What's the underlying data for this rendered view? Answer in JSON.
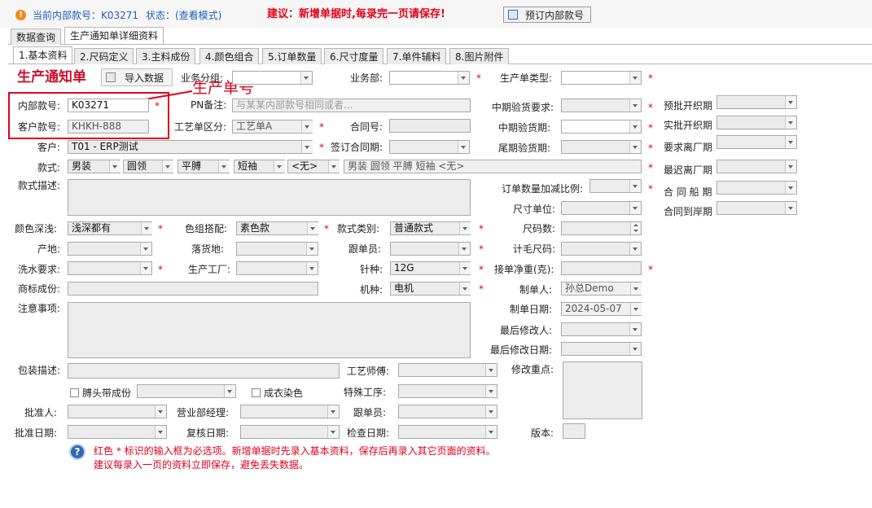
{
  "header": {
    "current_code_label": "当前内部款号：K03271",
    "status_label": "状态：(查看模式)",
    "advice": "建议：新增单据时,每录完一页请保存!",
    "reserve_button": "预订内部款号"
  },
  "main_tabs": [
    "数据查询",
    "生产通知单详细资料"
  ],
  "sub_tabs": [
    "1.基本资料",
    "2.尺码定义",
    "3.主料成份",
    "4.颜色组合",
    "5.订单数量",
    "6.尺寸度量",
    "7.单件辅料",
    "8.图片附件"
  ],
  "form": {
    "title": "生产通知单",
    "import_button": "导入数据",
    "annotation": "生产单号",
    "labels": {
      "biz_group": "业务分组:",
      "biz_dept": "业务部:",
      "order_type": "生产单类型:",
      "inner_code": "内部款号:",
      "pn_note": "PN备注:",
      "mid_check_req": "中期验货要求:",
      "pre_cut": "预批开织期",
      "cust_code": "客户款号:",
      "proc_section": "工艺单区分:",
      "contract_no": "合同号:",
      "mid_check_date": "中期验货期:",
      "actual_cut": "实批开织期",
      "customer": "客户:",
      "sign_date": "签订合同期:",
      "final_check": "尾期验货期:",
      "req_leave": "要求离厂期",
      "style": "款式:",
      "latest_leave": "最迟离厂期",
      "style_desc": "款式描述:",
      "qty_adjust": "订单数量加减比例:",
      "ship_date": "合 同 船 期",
      "size_unit": "尺寸单位:",
      "arrival_date": "合同到岸期",
      "color_depth": "颜色深浅:",
      "color_match": "色组搭配:",
      "style_cat": "款式类别:",
      "size_count": "尺码数:",
      "origin": "产地:",
      "delivery": "落货地:",
      "follower": "跟单员:",
      "gauge_size": "计毛尺码:",
      "wash": "洗水要求:",
      "factory": "生产工厂:",
      "needle": "针种:",
      "net_weight": "接单净重(克):",
      "trademark": "商标成份:",
      "machine": "机种:",
      "creator": "制单人:",
      "notes": "注意事项:",
      "create_date": "制单日期:",
      "last_modifier": "最后修改人:",
      "last_modify_date": "最后修改日期:",
      "packing": "包装描述:",
      "craftsman": "工艺师傅:",
      "key_mods": "修改重点:",
      "special": "特殊工序:",
      "approver": "批准人:",
      "sales_mgr": "营业部经理:",
      "follower2": "跟单员:",
      "approve_date": "批准日期:",
      "review_date": "复核日期:",
      "check_date": "检查日期:",
      "version": "版本:"
    },
    "values": {
      "inner_code": "K03271",
      "cust_code": "KHKH-888",
      "pn_note_placeholder": "与某某内部款号相同或者...",
      "proc_section": "工艺单A",
      "customer": "T01 - ERP测试",
      "style_parts": [
        "男装",
        "圆领",
        "平膊",
        "短袖",
        "<无>"
      ],
      "style_combined": "男装  圆领  平膊  短袖  <无>",
      "color_depth": "浅深都有",
      "color_match": "素色款",
      "style_cat": "普通款式",
      "needle": "12G",
      "machine": "电机",
      "creator": "孙总Demo",
      "create_date": "2024-05-07"
    },
    "checkboxes": {
      "collar_strip": "膊头带成份",
      "dyed": "成衣染色"
    }
  },
  "footer": {
    "line1": "红色 * 标识的输入框为必选项。新增单据时先录入基本资料，保存后再录入其它页面的资料。",
    "line2": "建议每录入一页的资料立即保存，避免丢失数据。"
  },
  "colors": {
    "accent": "#e0001b",
    "link_blue": "#1f5fbf",
    "annotation": "#e0001b"
  }
}
